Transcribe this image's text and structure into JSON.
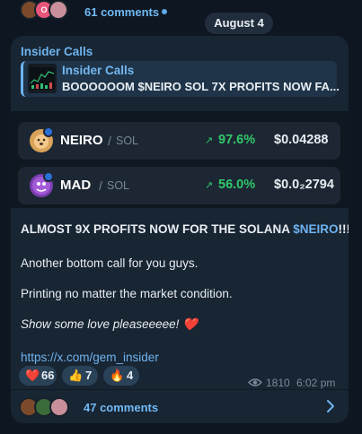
{
  "top_bar": {
    "comments_label": "61 comments",
    "avatar_badge": "O"
  },
  "date_pill": "August 4",
  "post": {
    "sender": "Insider Calls",
    "reply": {
      "title": "Insider Calls",
      "text": "BOOOOOOM $NEIRO SOL 7X PROFITS NOW FA..."
    },
    "tokens": [
      {
        "symbol": "NEIRO",
        "chain": "SOL",
        "change": "97.6%",
        "price": "$0.04288"
      },
      {
        "symbol": "MAD",
        "chain": "SOL",
        "change": "56.0%",
        "price": "$0.0₂2794"
      }
    ],
    "headline_prefix": "ALMOST 9X PROFITS NOW FOR THE SOLANA ",
    "headline_ticker": "$NEIRO",
    "headline_suffix": "!!! 🔥",
    "line2": "Another bottom call for you guys.",
    "line3": "Printing no matter the market condition.",
    "line4": "Show some love pleaseeeee! ❤️",
    "link": "https://x.com/gem_insider",
    "reactions": [
      {
        "emoji": "❤️",
        "count": "66"
      },
      {
        "emoji": "👍",
        "count": "7"
      },
      {
        "emoji": "🔥",
        "count": "4"
      }
    ],
    "views": "1810",
    "time": "6:02 pm",
    "comments_label": "47 comments"
  },
  "colors": {
    "background": "#0e1621",
    "bubble": "#182533",
    "accent": "#6fb3ef",
    "positive": "#31c76a"
  }
}
